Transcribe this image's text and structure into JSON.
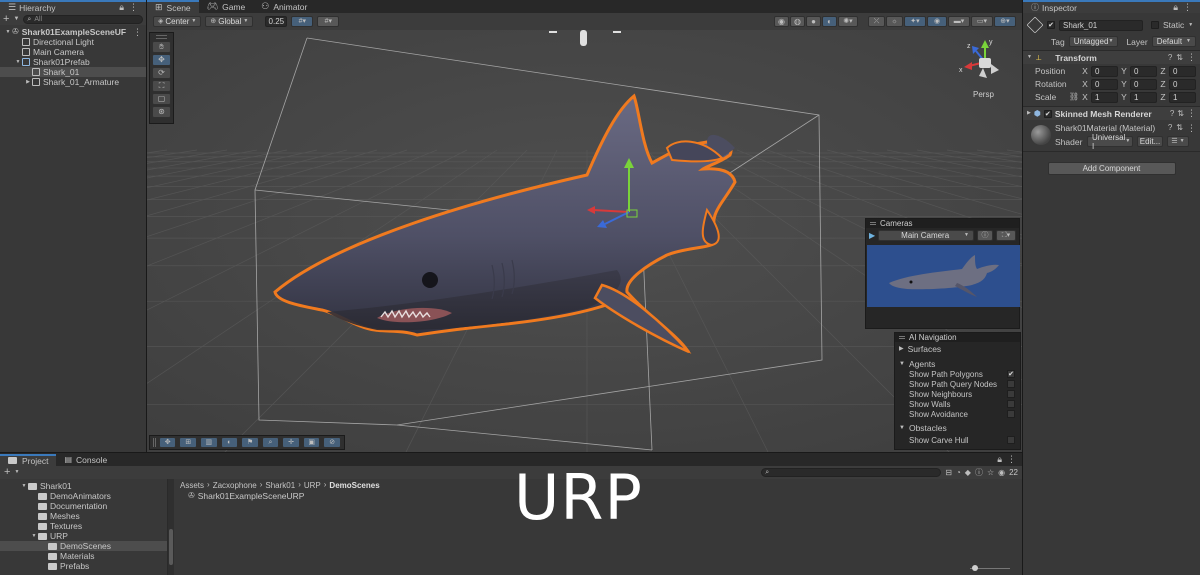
{
  "hierarchy": {
    "tab_label": "Hierarchy",
    "search_placeholder": "All",
    "items": [
      {
        "label": "Shark01ExampleSceneUF",
        "indent": 0,
        "kind": "scene"
      },
      {
        "label": "Directional Light",
        "indent": 1,
        "kind": "obj"
      },
      {
        "label": "Main Camera",
        "indent": 1,
        "kind": "obj"
      },
      {
        "label": "Shark01Prefab",
        "indent": 1,
        "kind": "prefab"
      },
      {
        "label": "Shark_01",
        "indent": 2,
        "kind": "obj",
        "selected": true
      },
      {
        "label": "Shark_01_Armature",
        "indent": 2,
        "kind": "obj"
      }
    ]
  },
  "tabs": {
    "scene": "Scene",
    "game": "Game",
    "animator": "Animator"
  },
  "scene_toolbar": {
    "pivot": "Center",
    "space": "Global",
    "snap": "0.25"
  },
  "gizmo": {
    "persp_label": "Persp",
    "x_label": "x",
    "y_label": "y",
    "z_label": "z"
  },
  "cameras_overlay": {
    "title": "Cameras",
    "camera": "Main Camera"
  },
  "ai_nav": {
    "title": "AI Navigation",
    "surfaces": "Surfaces",
    "agents": "Agents",
    "agent_items": [
      {
        "label": "Show Path Polygons",
        "checked": true
      },
      {
        "label": "Show Path Query Nodes",
        "checked": false
      },
      {
        "label": "Show Neighbours",
        "checked": false
      },
      {
        "label": "Show Walls",
        "checked": false
      },
      {
        "label": "Show Avoidance",
        "checked": false
      }
    ],
    "obstacles": "Obstacles",
    "obstacle_items": [
      {
        "label": "Show Carve Hull",
        "checked": false
      }
    ]
  },
  "inspector": {
    "tab_label": "Inspector",
    "object_name": "Shark_01",
    "static_label": "Static",
    "tag_label": "Tag",
    "tag_value": "Untagged",
    "layer_label": "Layer",
    "layer_value": "Default",
    "transform": {
      "title": "Transform",
      "position_label": "Position",
      "rotation_label": "Rotation",
      "scale_label": "Scale",
      "position": [
        "0",
        "0",
        "0"
      ],
      "rotation": [
        "0",
        "0",
        "0"
      ],
      "scale": [
        "1",
        "1",
        "1"
      ],
      "x": "X",
      "y": "Y",
      "z": "Z"
    },
    "renderer": {
      "title": "Skinned Mesh Renderer",
      "material": "Shark01Material (Material)",
      "shader_label": "Shader",
      "shader_value": "Universal I",
      "edit_label": "Edit..."
    },
    "add_component": "Add Component"
  },
  "project": {
    "tab_project": "Project",
    "tab_console": "Console",
    "tree": [
      {
        "label": "Shark01",
        "indent": 0
      },
      {
        "label": "DemoAnimators",
        "indent": 1
      },
      {
        "label": "Documentation",
        "indent": 1
      },
      {
        "label": "Meshes",
        "indent": 1
      },
      {
        "label": "Textures",
        "indent": 1
      },
      {
        "label": "URP",
        "indent": 1
      },
      {
        "label": "DemoScenes",
        "indent": 2,
        "selected": true
      },
      {
        "label": "Materials",
        "indent": 2
      },
      {
        "label": "Prefabs",
        "indent": 2
      }
    ],
    "breadcrumb": [
      "Assets",
      "Zacxophone",
      "Shark01",
      "URP",
      "DemoScenes"
    ],
    "files": [
      "Shark01ExampleSceneURP"
    ],
    "count": "22"
  },
  "watermark": "URP",
  "colors": {
    "accent": "#3a79bb",
    "selection_outline": "#f07a1f",
    "scene_bg": "#474747",
    "panel_bg": "#383838"
  }
}
